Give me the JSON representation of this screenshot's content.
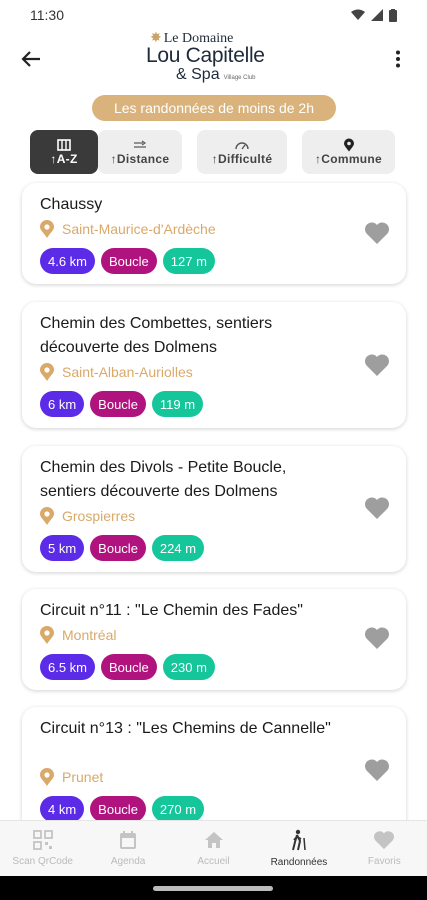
{
  "status_bar": {
    "time": "11:30"
  },
  "header": {
    "logo": {
      "line1": "Le Domaine",
      "line2": "Lou Capitelle",
      "line3": "& Spa",
      "small": "Village Club"
    }
  },
  "banner": {
    "text": "Les randonnées de moins de 2h"
  },
  "filters": [
    {
      "label": "↑A-Z",
      "icon": "map-icon",
      "active": true
    },
    {
      "label": "↑Distance",
      "icon": "distance-icon",
      "active": false
    },
    {
      "label": "↑Difficulté",
      "icon": "gauge-icon",
      "active": false
    },
    {
      "label": "↑Commune",
      "icon": "pin-icon",
      "active": false
    }
  ],
  "hikes": [
    {
      "title": "Chaussy",
      "location": "Saint-Maurice-d'Ardèche",
      "distance": "4.6 km",
      "type": "Boucle",
      "elevation": "127 m"
    },
    {
      "title": "Chemin des Combettes, sentiers découverte des Dolmens",
      "location": "Saint-Alban-Auriolles",
      "distance": "6 km",
      "type": "Boucle",
      "elevation": "119 m"
    },
    {
      "title": "Chemin des Divols - Petite Boucle, sentiers découverte des Dolmens",
      "location": "Grospierres",
      "distance": "5 km",
      "type": "Boucle",
      "elevation": "224 m"
    },
    {
      "title": "Circuit n°11 : \"Le Chemin des Fades\"",
      "location": "Montréal",
      "distance": "6.5 km",
      "type": "Boucle",
      "elevation": "230 m"
    },
    {
      "title": "Circuit n°13 : \"Les Chemins de Cannelle\"",
      "location": "Prunet",
      "distance": "4 km",
      "type": "Boucle",
      "elevation": "270 m"
    }
  ],
  "bottom_nav": [
    {
      "label": "Scan QrCode",
      "icon": "qrcode-icon",
      "active": false
    },
    {
      "label": "Agenda",
      "icon": "calendar-icon",
      "active": false
    },
    {
      "label": "Accueil",
      "icon": "home-icon",
      "active": false
    },
    {
      "label": "Randonnées",
      "icon": "hiker-icon",
      "active": true
    },
    {
      "label": "Favoris",
      "icon": "heart-icon",
      "active": false
    }
  ],
  "colors": {
    "accent_gold": "#d9b27c",
    "distance_tag": "#5b2be8",
    "type_tag": "#b0137e",
    "elevation_tag": "#14c69a"
  }
}
